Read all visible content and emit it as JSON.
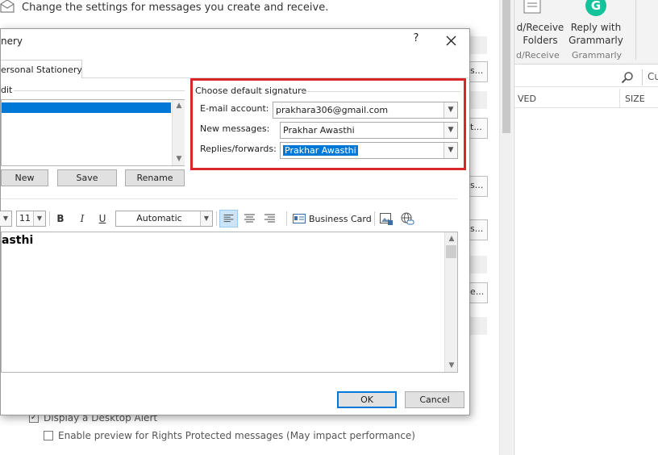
{
  "background": {
    "header_text": "Change the settings for messages you create and receive.",
    "right_stubs": [
      "s...",
      "t...",
      "s...",
      "s...",
      "e..."
    ],
    "options": {
      "desktop_alert": {
        "label": "Display a Desktop Alert",
        "checked": true
      },
      "preview_rights": {
        "label": "Enable preview for Rights Protected messages (May impact performance)",
        "checked": false
      }
    }
  },
  "ribbon": {
    "send_receive_label": "d/Receive\nFolders",
    "send_receive_group": "d/Receive",
    "grammarly_icon": "G",
    "grammarly_label": "Reply with\nGrammarly",
    "grammarly_group": "Grammarly",
    "search_placeholder": "Cu"
  },
  "mail_list": {
    "columns": [
      "VED",
      "SIZE"
    ]
  },
  "dialog": {
    "title": "nery",
    "help_label": "?",
    "tabs": [
      {
        "label": "ersonal Stationery"
      }
    ],
    "edit_legend": "dit",
    "buttons": {
      "new": "New",
      "save": "Save",
      "rename": "Rename",
      "ok": "OK",
      "cancel": "Cancel"
    },
    "defaults": {
      "legend": "Choose default signature",
      "email_account_label": "E-mail account:",
      "email_account_value": "prakhara306@gmail.com",
      "new_messages_label": "New messages:",
      "new_messages_value": "Prakhar Awasthi",
      "replies_label": "Replies/forwards:",
      "replies_value": "Prakhar Awasthi"
    },
    "toolbar": {
      "font_size": "11",
      "bold": "B",
      "italic": "I",
      "underline": "U",
      "color": "Automatic",
      "business_card": "Business Card"
    },
    "editor_text": "asthi"
  },
  "colors": {
    "accent": "#0078d7",
    "highlight_box": "#d9262b",
    "grammarly": "#15c39a"
  }
}
